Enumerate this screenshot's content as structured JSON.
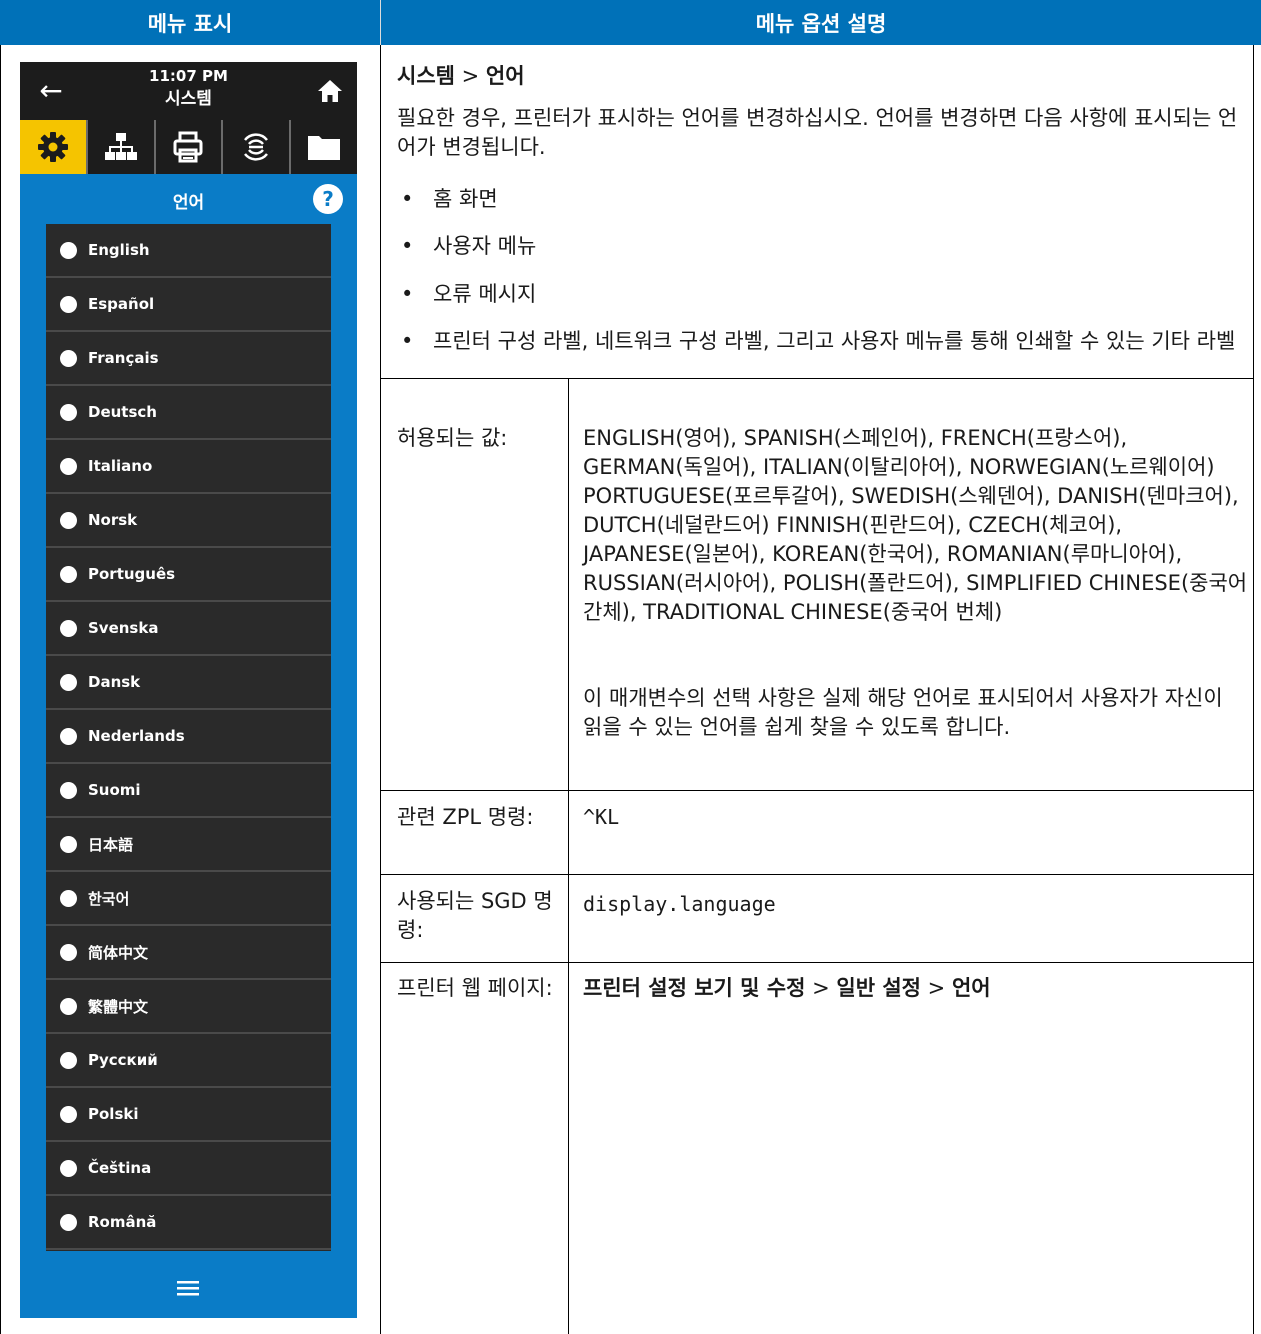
{
  "table_headers": {
    "menu_display": "메뉴 표시",
    "menu_option_description": "메뉴 옵션 설명"
  },
  "device": {
    "time": "11:07 PM",
    "screen_title": "시스템",
    "section_title": "언어",
    "help_symbol": "?",
    "languages": [
      "English",
      "Español",
      "Français",
      "Deutsch",
      "Italiano",
      "Norsk",
      "Português",
      "Svenska",
      "Dansk",
      "Nederlands",
      "Suomi",
      "日本語",
      "한국어",
      "简体中文",
      "繁體中文",
      "Русский",
      "Polski",
      "Čeština",
      "Română"
    ],
    "colors": {
      "panel_blue": "#0a7cc7",
      "active_tab": "#f5c400",
      "header_blue": "#0071b8"
    },
    "icons": [
      "back-arrow-icon",
      "home-icon",
      "settings-gear-icon",
      "network-icon",
      "printer-icon",
      "rfid-icon",
      "folder-icon",
      "help-icon",
      "menu-icon"
    ]
  },
  "description": {
    "crumb_system": "시스템",
    "crumb_sep": " > ",
    "crumb_language": "언어",
    "intro": "필요한 경우, 프린터가 표시하는 언어를 변경하십시오. 언어를 변경하면 다음 사항에 표시되는 언어가 변경됩니다.",
    "bullets": [
      "홈 화면",
      "사용자 메뉴",
      "오류 메시지",
      "프린터 구성 라벨, 네트워크 구성 라벨, 그리고 사용자 메뉴를 통해 인쇄할 수 있는 기타 라벨"
    ]
  },
  "rows": {
    "accepted_label": "허용되는 값:",
    "accepted_values": "ENGLISH(영어), SPANISH(스페인어), FRENCH(프랑스어), GERMAN(독일어), ITALIAN(이탈리아어), NORWEGIAN(노르웨이어) PORTUGUESE(포르투갈어), SWEDISH(스웨덴어), DANISH(덴마크어), DUTCH(네덜란드어) FINNISH(핀란드어), CZECH(체코어), JAPANESE(일본어), KOREAN(한국어), ROMANIAN(루마니아어), RUSSIAN(러시아어), POLISH(폴란드어), SIMPLIFIED CHINESE(중국어 간체), TRADITIONAL CHINESE(중국어 번체)",
    "accepted_note": "이 매개변수의 선택 사항은 실제 해당 언어로 표시되어서 사용자가 자신이 읽을 수 있는 언어를 쉽게 찾을 수 있도록 합니다.",
    "zpl_label": "관련 ZPL 명령:",
    "zpl_value": "^KL",
    "sgd_label": "사용되는 SGD 명령:",
    "sgd_value": "display.language",
    "web_label": "프린터 웹 페이지:",
    "web_part1": "프린터 설정 보기 및 수정",
    "web_sep1": " > ",
    "web_part2": "일반 설정",
    "web_sep2": " > ",
    "web_part3": "언어"
  }
}
